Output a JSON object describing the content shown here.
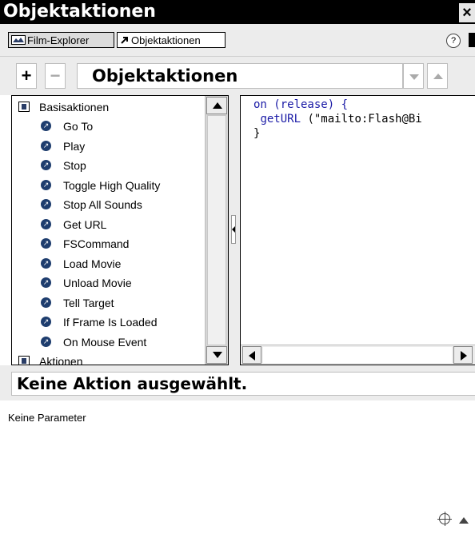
{
  "window": {
    "title": "Objektaktionen",
    "close_glyph": "×"
  },
  "tabs": [
    {
      "label": "Film-Explorer",
      "icon": "film-explorer-icon"
    },
    {
      "label": "Objektaktionen",
      "icon": "action-arrow-icon"
    }
  ],
  "tabbar": {
    "help_glyph": "?"
  },
  "toolbar": {
    "add_label": "+",
    "remove_label": "−",
    "title": "Objektaktionen"
  },
  "toolbox": {
    "category": "Basisaktionen",
    "items": [
      "Go To",
      "Play",
      "Stop",
      "Toggle High Quality",
      "Stop All Sounds",
      "Get URL",
      "FSCommand",
      "Load Movie",
      "Unload Movie",
      "Tell Target",
      "If Frame Is Loaded",
      "On Mouse Event"
    ],
    "next_category": "Aktionen"
  },
  "code": {
    "line1_kw": "on",
    "line1_rest": " (release) {",
    "line2_kw": "getURL",
    "line2_rest": " (\"mailto:Flash@Bi",
    "line3": "}"
  },
  "status": {
    "text": "Keine Aktion ausgewählt."
  },
  "params": {
    "text": "Keine Parameter"
  },
  "colors": {
    "titlebar": "#000000",
    "panel_bg": "#ececec",
    "bullet": "#1e3d6e",
    "keyword": "#1a1aa6"
  }
}
